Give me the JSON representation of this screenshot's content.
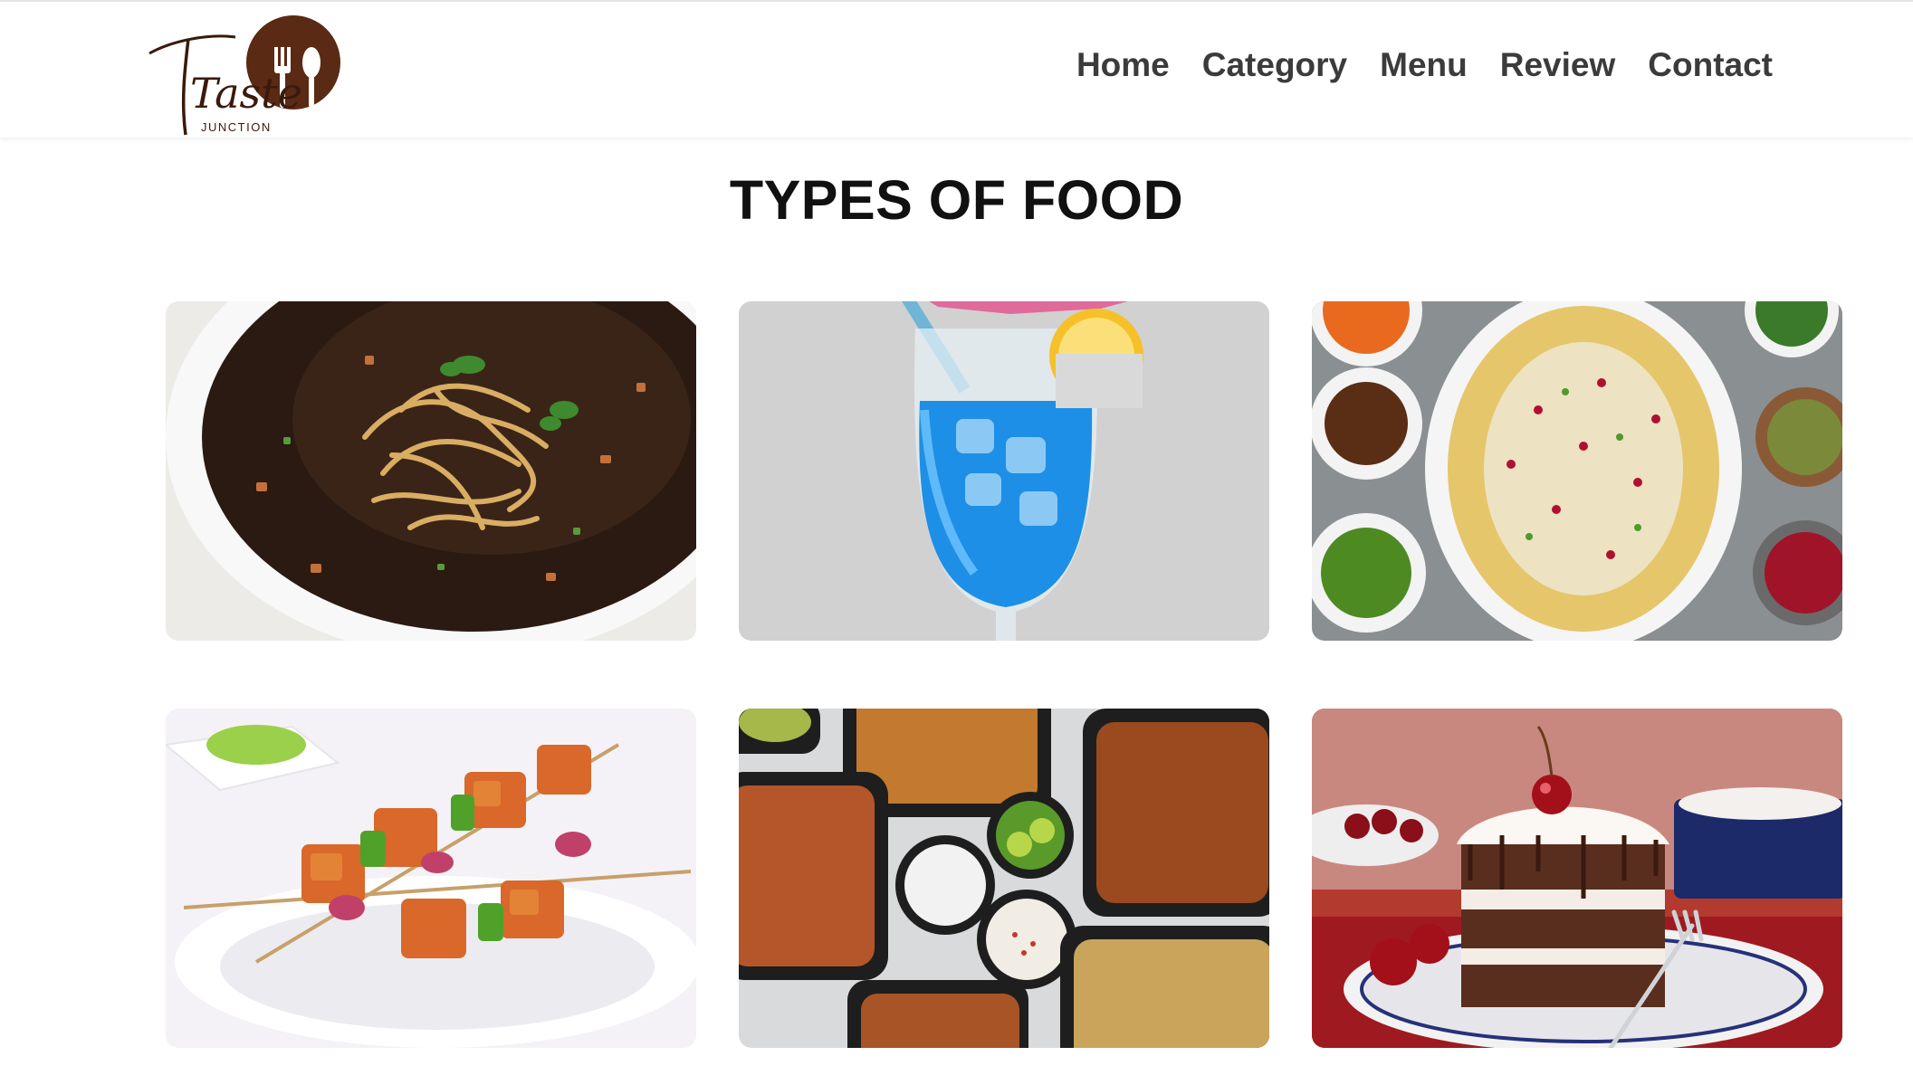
{
  "logo": {
    "script_text": "Taste",
    "sub_text": "JUNCTION",
    "brand_color": "#5a2a14"
  },
  "nav": {
    "items": [
      {
        "label": "Home"
      },
      {
        "label": "Category"
      },
      {
        "label": "Menu"
      },
      {
        "label": "Review"
      },
      {
        "label": "Contact"
      }
    ]
  },
  "section": {
    "title": "TYPES OF FOOD"
  },
  "food_cards": [
    {
      "icon": "soup-bowl-image"
    },
    {
      "icon": "blue-drink-image"
    },
    {
      "icon": "chaat-platter-image"
    },
    {
      "icon": "paneer-tikka-image"
    },
    {
      "icon": "curry-dishes-image"
    },
    {
      "icon": "chocolate-cake-image"
    }
  ],
  "colors": {
    "nav_text": "#3b3b3b",
    "title_text": "#111111"
  }
}
